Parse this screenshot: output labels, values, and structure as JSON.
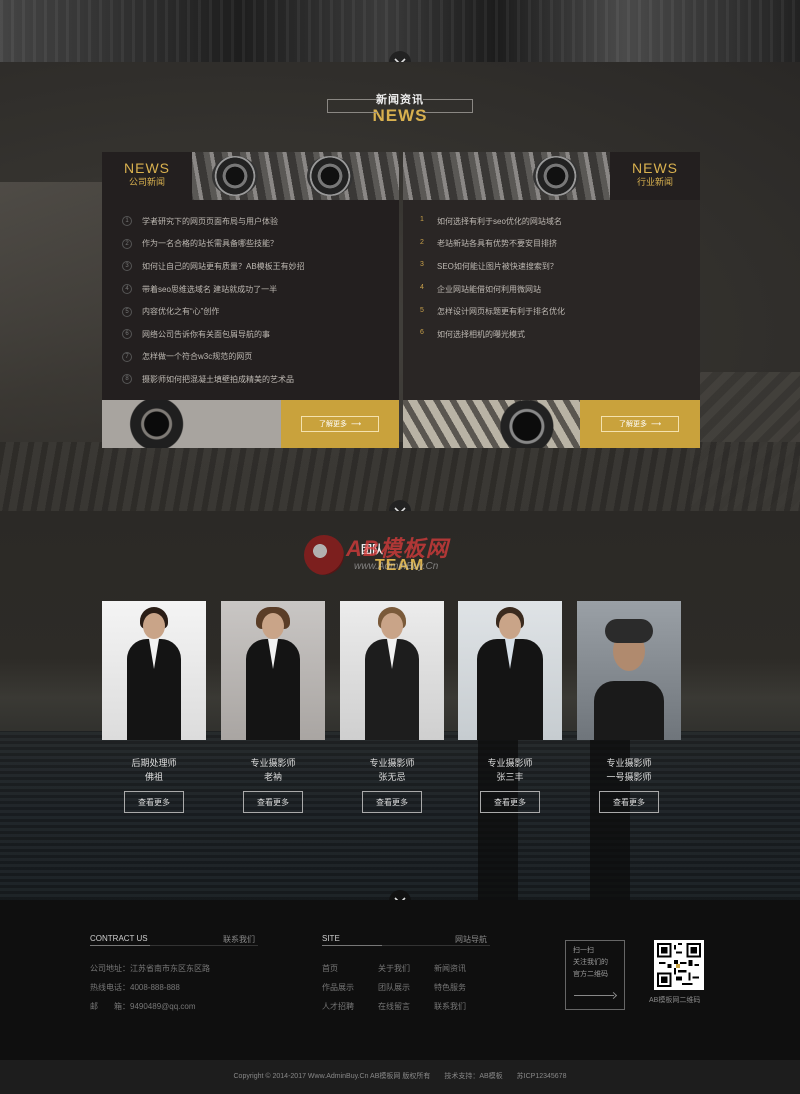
{
  "news": {
    "title_cn": "新闻资讯",
    "title_en": "NEWS",
    "company": {
      "tag_en": "NEWS",
      "tag_cn": "公司新闻",
      "more": "了解更多",
      "items": [
        {
          "n": "1",
          "t": "学者研究下的网页页面布局与用户体验"
        },
        {
          "n": "2",
          "t": "作为一名合格的站长需具备哪些技能？"
        },
        {
          "n": "3",
          "t": "如何让自己的网站更有质量？AB模板王有妙招"
        },
        {
          "n": "4",
          "t": "带着seo思维选域名 建站就成功了一半"
        },
        {
          "n": "5",
          "t": "内容优化之有“心”创作"
        },
        {
          "n": "6",
          "t": "网络公司告诉你有关面包屑导航的事"
        },
        {
          "n": "7",
          "t": "怎样做一个符合w3c规范的网页"
        },
        {
          "n": "8",
          "t": "摄影师如何把混凝土填壁拍成精美的艺术品"
        }
      ]
    },
    "industry": {
      "tag_en": "NEWS",
      "tag_cn": "行业新闻",
      "more": "了解更多",
      "items": [
        {
          "n": "1",
          "t": "如何选择有利于seo优化的网站域名"
        },
        {
          "n": "2",
          "t": "老站新站各具有优势不要安目排挤"
        },
        {
          "n": "3",
          "t": "SEO如何能让图片被快速搜索到？"
        },
        {
          "n": "4",
          "t": "企业网站能借如何利用微网站"
        },
        {
          "n": "5",
          "t": "怎样设计网页标题更有利于排名优化"
        },
        {
          "n": "6",
          "t": "如何选择相机的曝光模式"
        }
      ]
    }
  },
  "team": {
    "title_cn": "团队",
    "title_en": "TEAM",
    "watermark_brand": "AB模板网",
    "watermark_url": "www.AdminBuy.Cn",
    "members": [
      {
        "role": "后期处理师",
        "name": "佛祖",
        "btn": "查看更多"
      },
      {
        "role": "专业摄影师",
        "name": "老衲",
        "btn": "查看更多"
      },
      {
        "role": "专业摄影师",
        "name": "张无忌",
        "btn": "查看更多"
      },
      {
        "role": "专业摄影师",
        "name": "张三丰",
        "btn": "查看更多"
      },
      {
        "role": "专业摄影师",
        "name": "一号摄影师",
        "btn": "查看更多"
      }
    ]
  },
  "footer": {
    "contact_en": "CONTRACT US",
    "contact_cn": "联系我们",
    "address": "公司地址：江苏省南市东区东区路",
    "phone": "热线电话：4008-888-888",
    "email": "邮　　箱：9490489@qq.com",
    "site_en": "SITE",
    "site_cn": "网站导航",
    "links": [
      "首页",
      "关于我们",
      "新闻资讯",
      "作品展示",
      "团队展示",
      "特色服务",
      "人才招聘",
      "在线留言",
      "联系我们"
    ],
    "qr_text": [
      "扫一扫",
      "关注我们的",
      "官方二维码"
    ],
    "qr_caption": "AB模板网二维码"
  },
  "copyright": "Copyright © 2014-2017 Www.AdminBuy.Cn AB模板网 版权所有　　技术支持：AB模板　　苏ICP12345678"
}
